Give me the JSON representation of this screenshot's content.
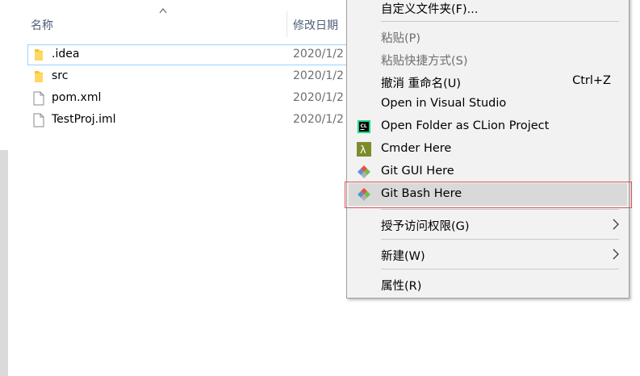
{
  "header": {
    "col_name": "名称",
    "col_date": "修改日期"
  },
  "files": [
    {
      "name": ".idea",
      "date": "2020/1/2",
      "type": "folder",
      "selected": true
    },
    {
      "name": "src",
      "date": "2020/1/2",
      "type": "folder",
      "selected": false
    },
    {
      "name": "pom.xml",
      "date": "2020/1/2",
      "type": "file",
      "selected": false
    },
    {
      "name": "TestProj.iml",
      "date": "2020/1/2",
      "type": "file",
      "selected": false
    }
  ],
  "context_menu": {
    "custom_folder": "自定义文件夹(F)...",
    "paste": "粘贴(P)",
    "paste_shortcut": "粘贴快捷方式(S)",
    "undo_rename": "撤消 重命名(U)",
    "undo_shortcut": "Ctrl+Z",
    "open_vs": "Open in Visual Studio",
    "open_clion": "Open Folder as CLion Project",
    "cmder": "Cmder Here",
    "git_gui": "Git GUI Here",
    "git_bash": "Git Bash Here",
    "grant_access": "授予访问权限(G)",
    "new": "新建(W)",
    "properties": "属性(R)"
  },
  "colors": {
    "folder": "#f8c22e",
    "clion": "#21d789",
    "cmder": "#7b8c2b",
    "git_red": "#e8523a",
    "git_blue": "#5c8fd6",
    "git_green": "#6dbf4e"
  },
  "icons": {
    "folder": "folder-icon",
    "file": "document-icon",
    "clion": "clion-icon",
    "cmder": "lambda-icon",
    "git": "git-diamond-icon"
  }
}
